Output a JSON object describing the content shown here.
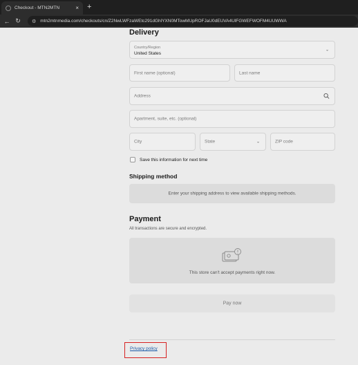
{
  "browser": {
    "tab_title": "Checkout - MTN2MTN",
    "tab_close": "×",
    "new_tab": "+",
    "back": "←",
    "reload": "↻",
    "site_settings": "⚙",
    "url": "mtn2mtnmedia.com/checkouts/cn/Z2NwLWFzaWEtc291dGhlYXN0MTowMUpROFJaU0dEUVA4UlFGWEFWOFM4UUWWA"
  },
  "delivery": {
    "title": "Delivery",
    "country_label": "Country/Region",
    "country_value": "United States",
    "first_name_placeholder": "First name (optional)",
    "last_name_placeholder": "Last name",
    "address_placeholder": "Address",
    "apartment_placeholder": "Apartment, suite, etc. (optional)",
    "city_placeholder": "City",
    "state_placeholder": "State",
    "zip_placeholder": "ZIP code",
    "save_info_label": "Save this information for next time"
  },
  "shipping": {
    "title": "Shipping method",
    "message": "Enter your shipping address to view available shipping methods."
  },
  "payment": {
    "title": "Payment",
    "subtitle": "All transactions are secure and encrypted.",
    "notice": "This store can't accept payments right now.",
    "pay_button": "Pay now"
  },
  "footer": {
    "privacy_policy": "Privacy policy"
  },
  "colors": {
    "page_bg": "#ebebeb",
    "highlight": "#d62020",
    "link": "#1a5aa8"
  }
}
